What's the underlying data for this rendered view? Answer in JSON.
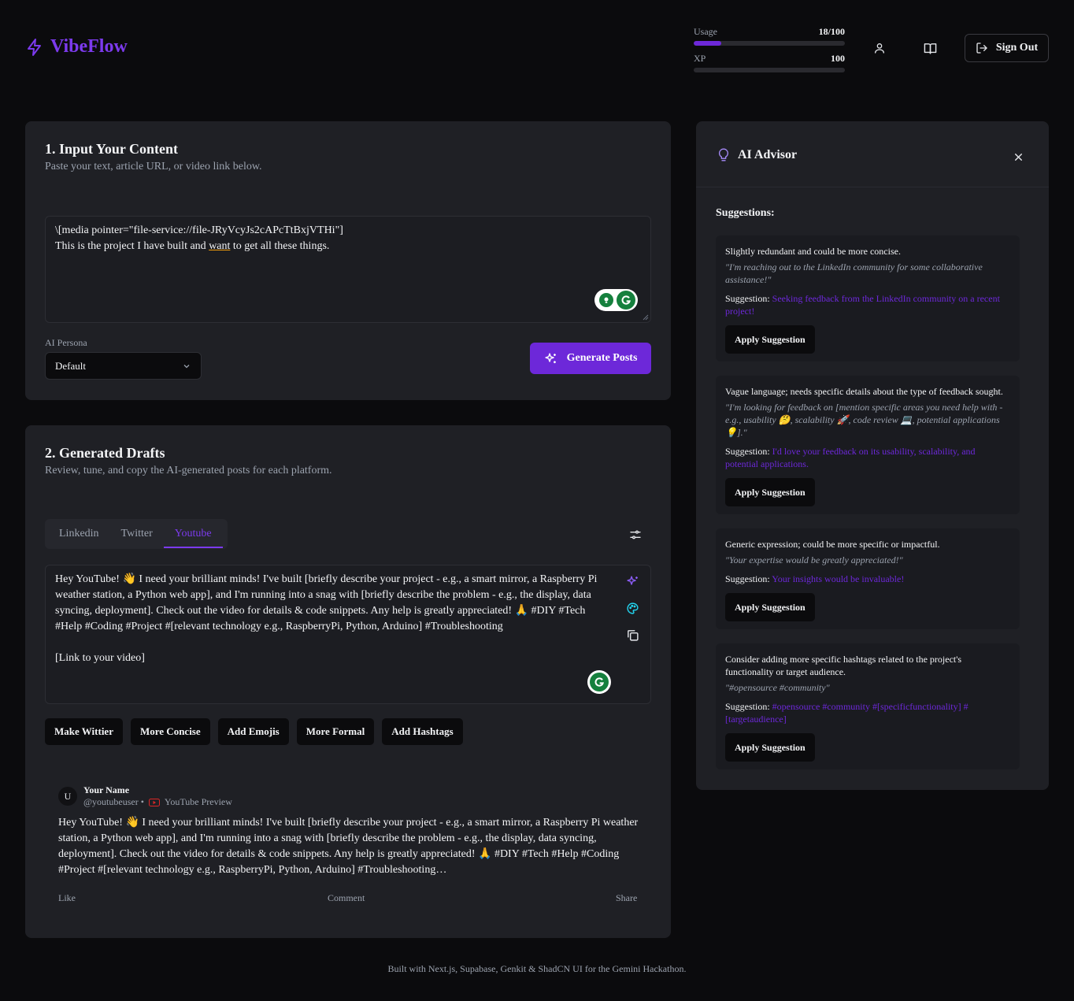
{
  "header": {
    "brand": "VibeFlow",
    "usage_label": "Usage",
    "usage_value": "18/100",
    "usage_fraction": 0.18,
    "xp_label": "XP",
    "xp_value": "100",
    "xp_fraction": 0,
    "signout_label": "Sign Out",
    "icons": [
      "zap-icon",
      "user-icon",
      "book-open-icon",
      "log-out-icon"
    ]
  },
  "input_card": {
    "title": "1. Input Your Content",
    "subtitle": "Paste your text, article URL, or video link below.",
    "text_line1": "\\[media pointer=\"file-service://file-JRyVcyJs2cAPcTtBxjVTHi\"]",
    "text_line2_a": "This is the project I have built and ",
    "text_line2_b": "want",
    "text_line2_c": " to get all these things.",
    "persona_label": "AI Persona",
    "persona_value": "Default",
    "generate_label": "Generate Posts"
  },
  "drafts_card": {
    "title": "2. Generated Drafts",
    "subtitle": "Review, tune, and copy the AI-generated posts for each platform.",
    "tabs": [
      "Linkedin",
      "Twitter",
      "Youtube"
    ],
    "active_tab": "Youtube",
    "draft_text": "Hey YouTube! 👋 I need your brilliant minds! I've built [briefly describe your project - e.g., a smart mirror, a Raspberry Pi weather station, a Python web app], and I'm running into a snag with [briefly describe the problem - e.g., the display, data syncing, deployment]. Check out the video for details & code snippets. Any help is greatly appreciated! 🙏 #DIY #Tech #Help #Coding #Project #[relevant technology e.g., RaspberryPi, Python, Arduino] #Troubleshooting",
    "draft_link": "[Link to your video]",
    "actions": [
      "Make Wittier",
      "More Concise",
      "Add Emojis",
      "More Formal",
      "Add Hashtags"
    ],
    "preview": {
      "avatar_letter": "U",
      "name": "Your Name",
      "handle": "@youtubeuser •",
      "platform_label": "YouTube Preview",
      "body": " Hey YouTube! 👋 I need your brilliant minds! I've built [briefly describe your project - e.g., a smart mirror, a Raspberry Pi weather station, a Python web app], and I'm running into a snag with [briefly describe the problem - e.g., the display, data syncing, deployment]. Check out the video for details & code snippets. Any help is greatly appreciated! 🙏 #DIY #Tech #Help #Coding #Project #[relevant technology e.g., RaspberryPi, Python, Arduino] #Troubleshooting…",
      "like": "Like",
      "comment": "Comment",
      "share": "Share"
    }
  },
  "advisor": {
    "title": "AI Advisor",
    "suggestions_heading": "Suggestions:",
    "suggestion_label": "Suggestion:",
    "apply_label": "Apply Suggestion",
    "items": [
      {
        "issue": "Slightly redundant and could be more concise.",
        "quote": "\"I'm reaching out to the LinkedIn community for some collaborative assistance!\"",
        "suggestion": "Seeking feedback from the LinkedIn community on a recent project!"
      },
      {
        "issue": "Vague language; needs specific details about the type of feedback sought.",
        "quote": "\"I'm looking for feedback on [mention specific areas you need help with - e.g., usability 🤔, scalability 🚀, code review 💻, potential applications 💡].\"",
        "suggestion": "I'd love your feedback on its usability, scalability, and potential applications."
      },
      {
        "issue": "Generic expression; could be more specific or impactful.",
        "quote": "\"Your expertise would be greatly appreciated!\"",
        "suggestion": "Your insights would be invaluable!"
      },
      {
        "issue": "Consider adding more specific hashtags related to the project's functionality or target audience.",
        "quote": "\"#opensource #community\"",
        "suggestion": "#opensource #community #[specificfunctionality] #[targetaudience]"
      }
    ]
  },
  "footer": "Built with Next.js, Supabase, Genkit & ShadCN UI for the Gemini Hackathon.",
  "colors": {
    "accent": "#7c3aed",
    "background": "#0b0b0d",
    "card": "#1f2025"
  }
}
